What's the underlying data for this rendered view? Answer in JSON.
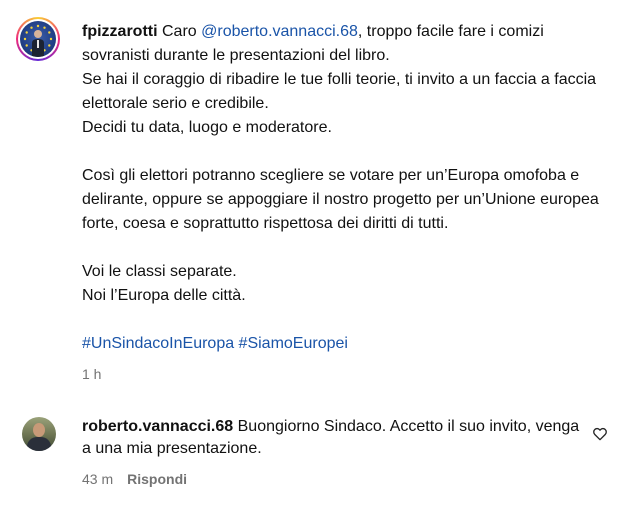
{
  "post": {
    "username": "fpizzarotti",
    "caption_intro": "Caro ",
    "mention": "@roberto.vannacci.68",
    "caption_rest": ", troppo facile fare i comizi sovranisti durante le presentazioni del libro.\nSe hai il coraggio di ribadire le tue folli teorie, ti invito a un faccia a faccia elettorale serio e credibile.\nDecidi tu data, luogo e moderatore.\n\nCosì gli elettori potranno scegliere se votare per un’Europa omofoba e delirante, oppure se appoggiare il nostro progetto per un’Unione europea forte, coesa e soprattutto rispettosa dei diritti di tutti.\n\nVoi le classi separate.\nNoi l’Europa delle città.\n\n",
    "hashtags": "#UnSindacoInEuropa #SiamoEuropei",
    "time": "1 h",
    "avatar_icon": "profile-avatar-eu-flag"
  },
  "reply": {
    "username": "roberto.vannacci.68",
    "text": " Buongiorno Sindaco. Accetto il suo invito, venga a una mia presentazione.",
    "time": "43 m",
    "reply_label": "Rispondi",
    "like_icon": "heart-outline-icon"
  },
  "colors": {
    "link": "#1a54a8",
    "meta": "#737373",
    "text": "#111111"
  }
}
